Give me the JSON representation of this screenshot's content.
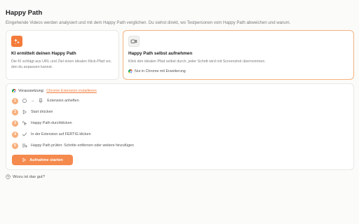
{
  "header": {
    "title": "Happy Path",
    "subtitle": "Eingehende Videos werden analysiert und mit dem Happy Path verglichen. Du siehst direkt, wo Testpersonen vom Happy Path abweichen und warum."
  },
  "cards": [
    {
      "icon": "sparkles-icon",
      "title": "KI ermittelt deinen Happy Path",
      "description": "Die KI schlägt aus URL und Ziel einen idealen Klick-Pfad vor, den du anpassen kannst."
    },
    {
      "icon": "video-camera-icon",
      "title": "Happy Path selbst aufnehmen",
      "description": "Klick den idealen Pfad selbst durch, jeder Schritt wird mit Screenshot übernommen.",
      "note": "Nur in Chrome mit Erweiterung"
    }
  ],
  "setup": {
    "prereq_label": "Voraussetzung:",
    "prereq_link": "Chrome Extension installieren",
    "steps": [
      {
        "number": "1",
        "arrow": "→",
        "text": "Extension anheften"
      },
      {
        "number": "2",
        "text": "Start drücken"
      },
      {
        "number": "3",
        "text": "Happy Path durchklicken"
      },
      {
        "number": "4",
        "text": "In der Extension auf FERTIG klicken"
      },
      {
        "number": "5",
        "text": "Happy Path prüfen: Schritte entfernen oder weitere hinzufügen"
      }
    ],
    "start_button": "Aufnahme starten"
  },
  "help_link": "Wozu ist das gut?",
  "colors": {
    "accent": "#f58a4e",
    "accent_light": "#f7b07c",
    "link": "#f07a3a",
    "selected_border": "#f4b37e"
  }
}
